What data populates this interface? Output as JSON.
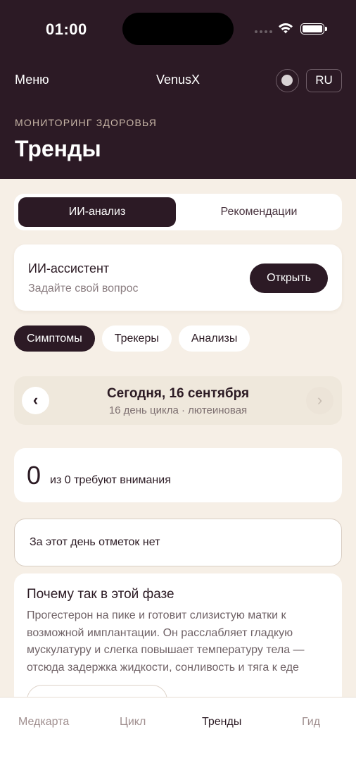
{
  "status_bar": {
    "time": "01:00"
  },
  "header": {
    "menu_label": "Меню",
    "app_name": "VenusX",
    "lang_label": "RU",
    "section_label": "МОНИТОРИНГ ЗДОРОВЬЯ",
    "page_title": "Тренды"
  },
  "segmented": {
    "active_label": "ИИ-анализ",
    "other_label": "Рекомендации"
  },
  "assistant": {
    "title": "ИИ-ассистент",
    "subtitle": "Задайте свой вопрос",
    "button_label": "Открыть"
  },
  "chips": [
    {
      "label": "Симптомы",
      "active": true
    },
    {
      "label": "Трекеры",
      "active": false
    },
    {
      "label": "Анализы",
      "active": false
    }
  ],
  "date_nav": {
    "prev_icon": "‹",
    "next_icon": "›",
    "title": "Сегодня, 16 сентября",
    "subtitle": "16 день цикла · лютеиновая"
  },
  "attention": {
    "count": "0",
    "text": "из 0 требуют внимания"
  },
  "empty_state": {
    "text": "За этот день отметок нет"
  },
  "why_card": {
    "title": "Почему так в этой фазе",
    "body": "Прогестерон на пике и готовит слизистую матки к возможной имплантации. Он расслабляет гладкую мускулатуру и слегка повышает температуру тела — отсюда задержка жидкости, сонливость и тяга к еде"
  },
  "tabbar": {
    "items": [
      {
        "label": "Медкарта"
      },
      {
        "label": "Цикл"
      },
      {
        "label": "Тренды"
      },
      {
        "label": "Гид"
      }
    ],
    "active": "Тренды"
  },
  "colors": {
    "header_bg": "#2c1a25",
    "page_bg": "#f6efe6",
    "accent_dark": "#2c1a25",
    "muted_text": "#8a7d80"
  }
}
